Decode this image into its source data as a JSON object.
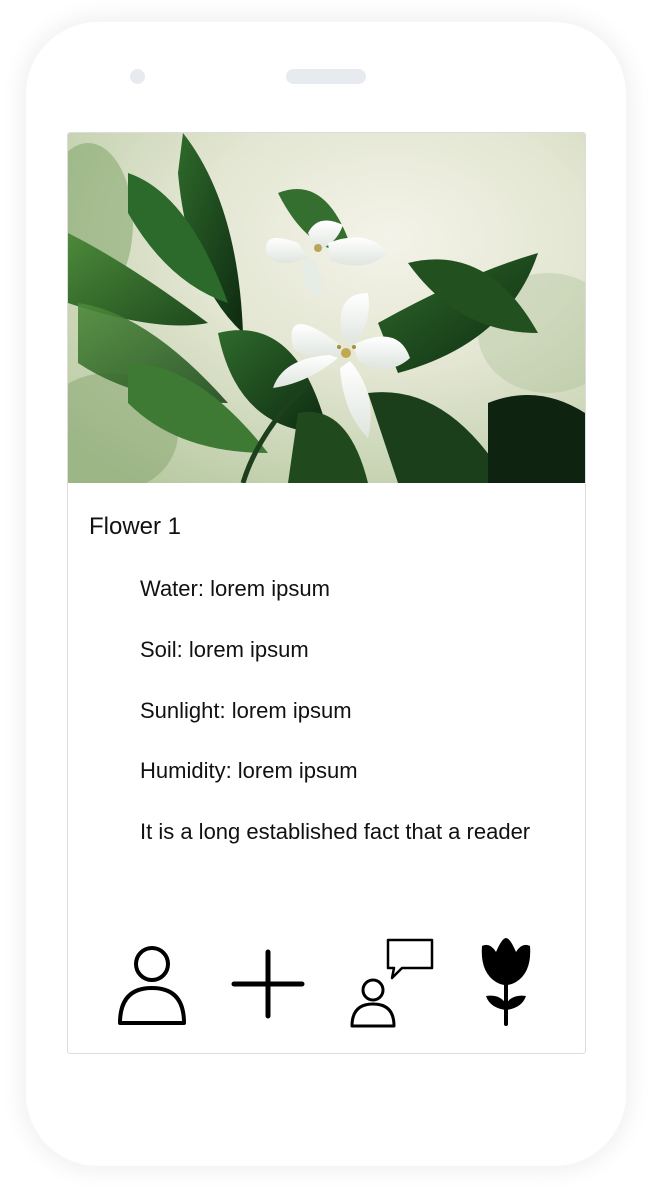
{
  "flower": {
    "title": "Flower 1",
    "photo_alt": "White flowers with green leaves",
    "details": [
      "Water: lorem ipsum",
      "Soil: lorem ipsum",
      "Sunlight: lorem ipsum",
      "Humidity: lorem ipsum",
      "It is a long established fact that a reader"
    ]
  },
  "bottom_nav": {
    "items": [
      {
        "icon": "user-icon"
      },
      {
        "icon": "plus-icon"
      },
      {
        "icon": "chat-user-icon"
      },
      {
        "icon": "tulip-icon"
      }
    ]
  },
  "colors": {
    "icon": "#000000",
    "text": "#111111",
    "device_frame": "#ffffff",
    "device_details": "#e7eaee"
  }
}
